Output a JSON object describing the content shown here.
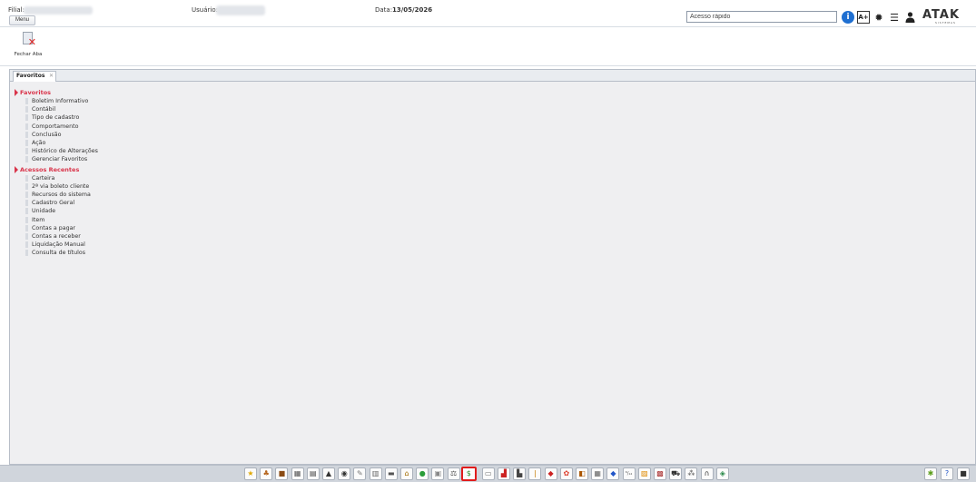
{
  "header": {
    "filial_label": "Filial:",
    "usuario_label": "Usuário:",
    "data_label": "Data:",
    "data_value": "13/05/2026",
    "menu_label": "Menu",
    "quick_access": "Acesso rápido",
    "font_size_label": "A+",
    "logo_text": "ATAK",
    "logo_sub": "SISTEMAS"
  },
  "toolbar": {
    "close_tab_label": "Fechar Aba"
  },
  "tabs": [
    {
      "label": "Favoritos",
      "close": "✕"
    }
  ],
  "tree": {
    "favorites_label": "Favoritos",
    "favorites": [
      "Boletim Informativo",
      "Contábil",
      "Tipo de cadastro",
      "Comportamento",
      "Conclusão",
      "Ação",
      "Histórico de Alterações",
      "Gerenciar Favoritos"
    ],
    "recent_label": "Acessos Recentes",
    "recent": [
      "Carteira",
      "2ª via boleto cliente",
      "Recursos do sistema",
      "Cadastro Geral",
      "Unidade",
      "Item",
      "Contas a pagar",
      "Contas a receber",
      "Liquidação Manual",
      "Consulta de títulos"
    ]
  },
  "bottom_icons": [
    {
      "name": "star-icon",
      "glyph": "★",
      "color": "#e0a800"
    },
    {
      "name": "people-icon",
      "glyph": "♣",
      "color": "#b5651d"
    },
    {
      "name": "briefcase-icon",
      "glyph": "■",
      "color": "#8a4b14"
    },
    {
      "name": "calculator-icon",
      "glyph": "▦",
      "color": "#555"
    },
    {
      "name": "ledger-icon",
      "glyph": "▤",
      "color": "#444"
    },
    {
      "name": "bank-icon",
      "glyph": "▲",
      "color": "#333"
    },
    {
      "name": "gauge-icon",
      "glyph": "◉",
      "color": "#333"
    },
    {
      "name": "pencil-icon",
      "glyph": "✎",
      "color": "#777"
    },
    {
      "name": "print-icon",
      "glyph": "▥",
      "color": "#666"
    },
    {
      "name": "report-icon",
      "glyph": "▬",
      "color": "#555"
    },
    {
      "name": "warehouse-icon",
      "glyph": "⌂",
      "color": "#a26b00"
    },
    {
      "name": "globe-icon",
      "glyph": "●",
      "color": "#2a9d3a"
    },
    {
      "name": "lock-icon",
      "glyph": "▣",
      "color": "#888"
    },
    {
      "name": "scale-icon",
      "glyph": "⚖",
      "color": "#444"
    },
    {
      "name": "dollar-icon",
      "glyph": "$",
      "color": "#2a8a2a",
      "selected": true
    },
    {
      "name": "document-icon",
      "glyph": "▭",
      "color": "#777"
    },
    {
      "name": "factory-icon",
      "glyph": "▟",
      "color": "#c22"
    },
    {
      "name": "truck-icon",
      "glyph": "▙",
      "color": "#444"
    },
    {
      "name": "bottle-icon",
      "glyph": "❘",
      "color": "#c57a00"
    },
    {
      "name": "tag-icon",
      "glyph": "◆",
      "color": "#c22"
    },
    {
      "name": "fruits-icon",
      "glyph": "✿",
      "color": "#d43"
    },
    {
      "name": "box-icon",
      "glyph": "◧",
      "color": "#a50"
    },
    {
      "name": "grid-icon",
      "glyph": "▦",
      "color": "#666"
    },
    {
      "name": "diamond-icon",
      "glyph": "◆",
      "color": "#2256c8"
    },
    {
      "name": "weight-icon",
      "glyph": "⁶/₁₂",
      "color": "#555"
    },
    {
      "name": "chart-icon",
      "glyph": "▨",
      "color": "#e08a00"
    },
    {
      "name": "crates-icon",
      "glyph": "▩",
      "color": "#a33"
    },
    {
      "name": "cart-icon",
      "glyph": "⛟",
      "color": "#333"
    },
    {
      "name": "network-icon",
      "glyph": "⁂",
      "color": "#555"
    },
    {
      "name": "headset-icon",
      "glyph": "∩",
      "color": "#333"
    },
    {
      "name": "cubes-icon",
      "glyph": "◈",
      "color": "#2a8a4a"
    }
  ],
  "bottom_right_icons": [
    {
      "name": "settings-star-icon",
      "glyph": "✱",
      "color": "#5a9e1a"
    },
    {
      "name": "help-icon",
      "glyph": "?",
      "color": "#2256c8"
    },
    {
      "name": "video-icon",
      "glyph": "■",
      "color": "#333"
    }
  ]
}
